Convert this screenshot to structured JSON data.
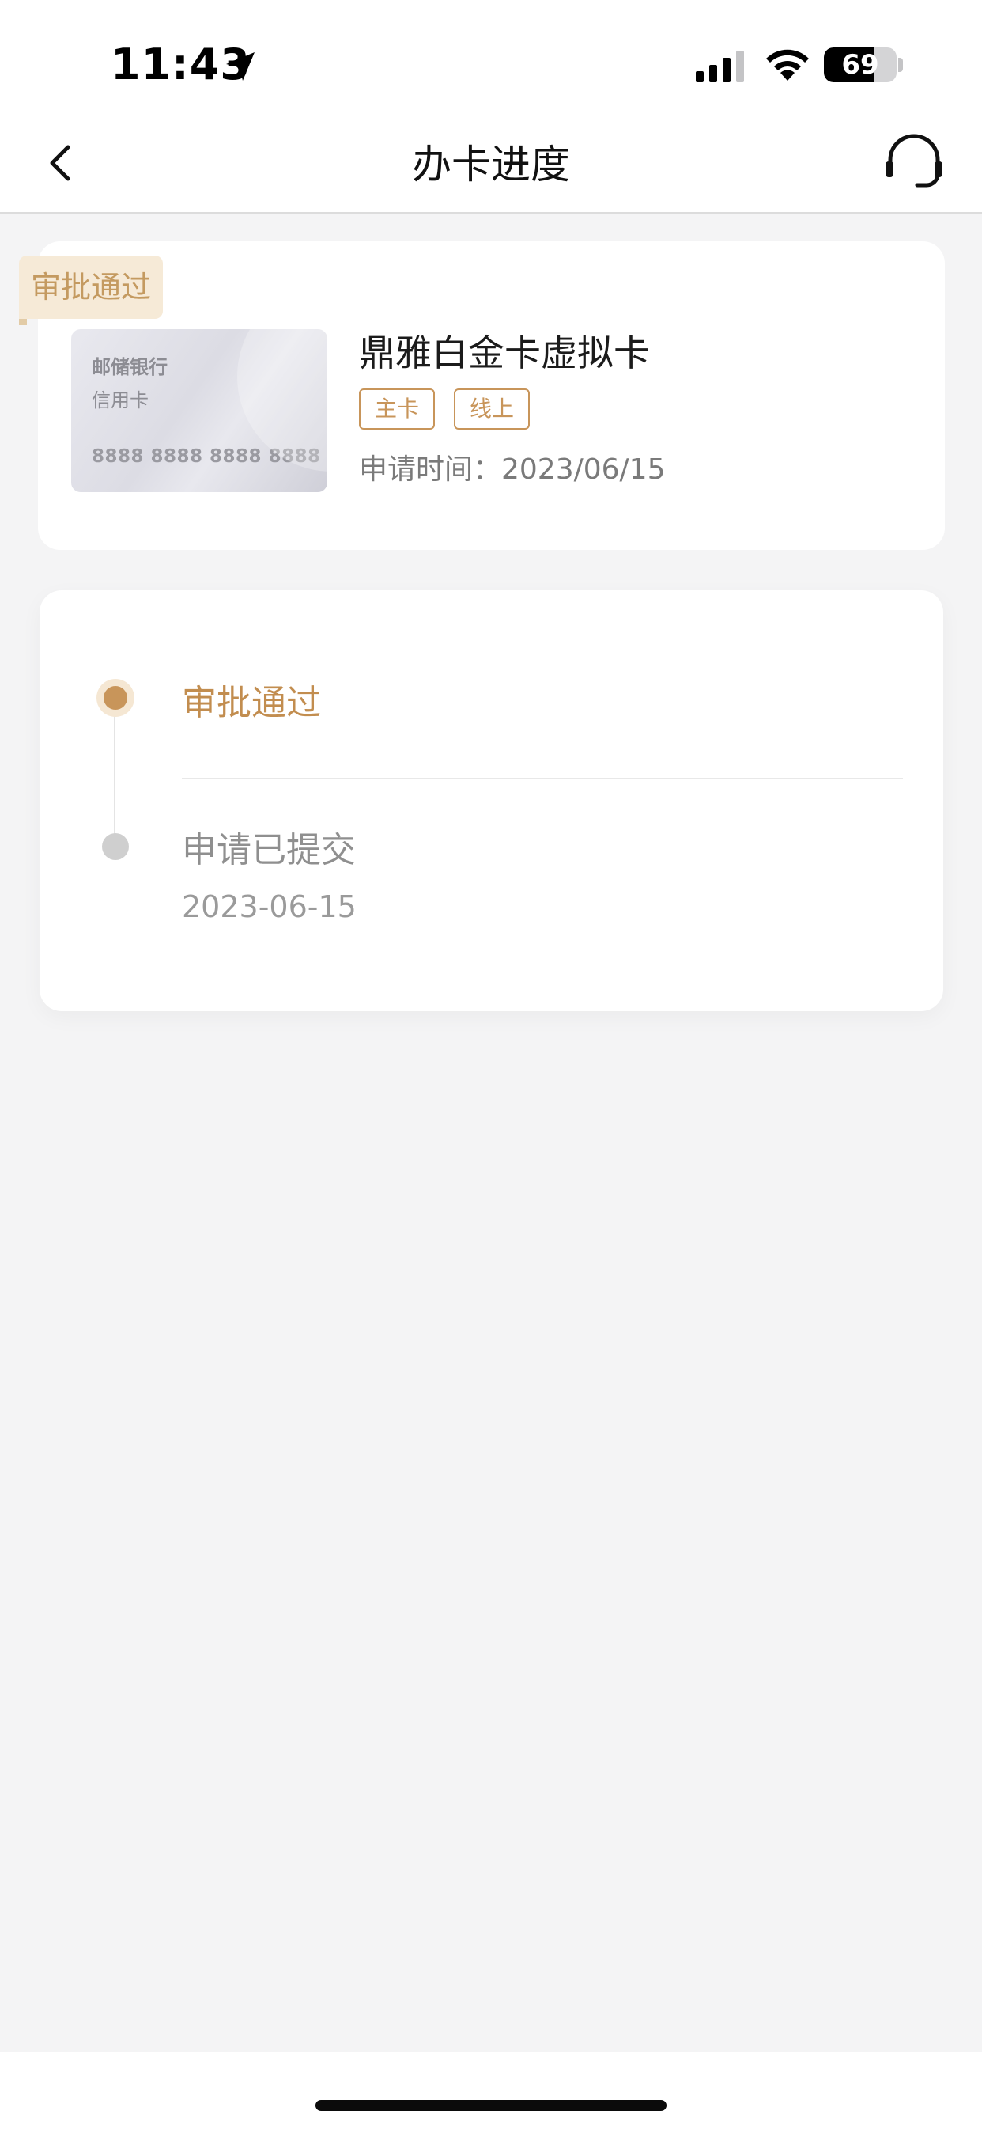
{
  "status_bar": {
    "time": "11:43",
    "battery": "69",
    "battery_level": 0.69
  },
  "nav": {
    "title": "办卡进度"
  },
  "card": {
    "status_tag": "审批通过",
    "bank_name": "邮储银行",
    "card_type": "信用卡",
    "card_number": "8888 8888 8888 8888",
    "product_name": "鼎雅白金卡虚拟卡",
    "tags": [
      "主卡",
      "线上"
    ],
    "apply_time": "申请时间：2023/06/15"
  },
  "progress": {
    "steps": [
      {
        "label": "审批通过",
        "date": "",
        "state": "active"
      },
      {
        "label": "申请已提交",
        "date": "2023-06-15",
        "state": "done"
      }
    ]
  },
  "colors": {
    "accent": "#c8955a",
    "accent_light": "#f6ead7",
    "background": "#f4f4f5"
  }
}
